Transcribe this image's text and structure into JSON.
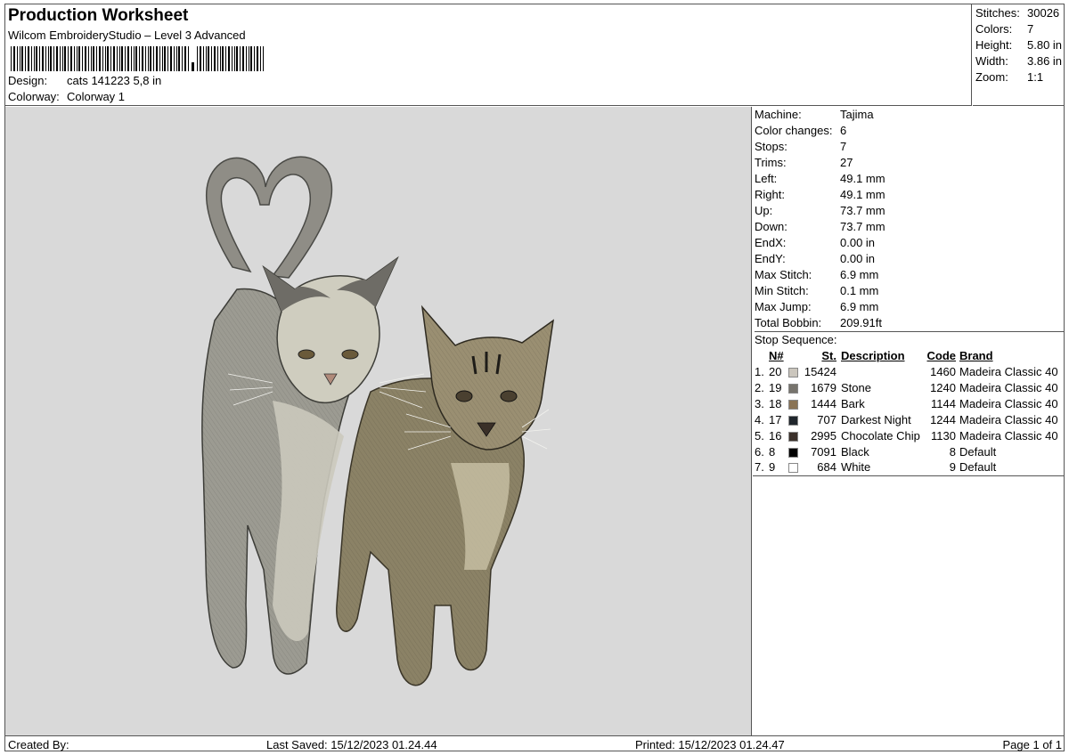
{
  "header": {
    "title": "Production Worksheet",
    "subtitle": "Wilcom EmbroideryStudio – Level 3 Advanced",
    "design_label": "Design:",
    "design_value": "cats 141223 5,8 in",
    "colorway_label": "Colorway:",
    "colorway_value": "Colorway 1"
  },
  "stats": [
    {
      "label": "Stitches:",
      "value": "30026"
    },
    {
      "label": "Colors:",
      "value": "7"
    },
    {
      "label": "Height:",
      "value": "5.80 in"
    },
    {
      "label": "Width:",
      "value": "3.86 in"
    },
    {
      "label": "Zoom:",
      "value": "1:1"
    }
  ],
  "machine_info": [
    {
      "label": "Machine:",
      "value": "Tajima"
    },
    {
      "label": "Color changes:",
      "value": "6"
    },
    {
      "label": "Stops:",
      "value": "7"
    },
    {
      "label": "Trims:",
      "value": "27"
    },
    {
      "label": "Left:",
      "value": "49.1 mm"
    },
    {
      "label": "Right:",
      "value": "49.1 mm"
    },
    {
      "label": "Up:",
      "value": "73.7 mm"
    },
    {
      "label": "Down:",
      "value": "73.7 mm"
    },
    {
      "label": "EndX:",
      "value": "0.00 in"
    },
    {
      "label": "EndY:",
      "value": "0.00 in"
    },
    {
      "label": "Max Stitch:",
      "value": "6.9 mm"
    },
    {
      "label": "Min Stitch:",
      "value": "0.1 mm"
    },
    {
      "label": "Max Jump:",
      "value": "6.9 mm"
    },
    {
      "label": "Total Bobbin:",
      "value": "209.91ft"
    }
  ],
  "stop_sequence": {
    "label": "Stop Sequence:",
    "headers": {
      "n": "N#",
      "st": "St.",
      "description": "Description",
      "code": "Code",
      "brand": "Brand"
    },
    "rows": [
      {
        "idx": "1.",
        "n": "20",
        "color": "#cbc6bd",
        "st": "15424",
        "description": "",
        "code": "1460",
        "brand": "Madeira Classic 40"
      },
      {
        "idx": "2.",
        "n": "19",
        "color": "#77746d",
        "st": "1679",
        "description": "Stone",
        "code": "1240",
        "brand": "Madeira Classic 40"
      },
      {
        "idx": "3.",
        "n": "18",
        "color": "#8a7456",
        "st": "1444",
        "description": "Bark",
        "code": "1144",
        "brand": "Madeira Classic 40"
      },
      {
        "idx": "4.",
        "n": "17",
        "color": "#20262c",
        "st": "707",
        "description": "Darkest Night",
        "code": "1244",
        "brand": "Madeira Classic 40"
      },
      {
        "idx": "5.",
        "n": "16",
        "color": "#3b302a",
        "st": "2995",
        "description": "Chocolate Chip",
        "code": "1130",
        "brand": "Madeira Classic 40"
      },
      {
        "idx": "6.",
        "n": "8",
        "color": "#000000",
        "st": "7091",
        "description": "Black",
        "code": "8",
        "brand": "Default"
      },
      {
        "idx": "7.",
        "n": "9",
        "color": "#ffffff",
        "st": "684",
        "description": "White",
        "code": "9",
        "brand": "Default"
      }
    ]
  },
  "footer": {
    "created_by": "Created By:",
    "last_saved": "Last Saved: 15/12/2023 01.24.44",
    "printed": "Printed: 15/12/2023 01.24.47",
    "page": "Page 1 of 1"
  }
}
